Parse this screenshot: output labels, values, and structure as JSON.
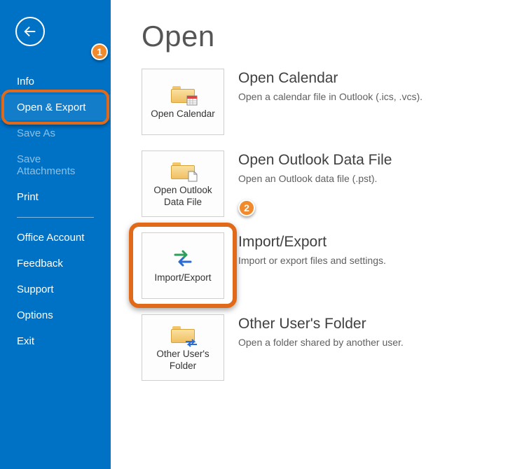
{
  "sidebar": {
    "items": [
      {
        "label": "Info",
        "dim": false
      },
      {
        "label": "Open & Export",
        "dim": false,
        "selected": true
      },
      {
        "label": "Save As",
        "dim": true
      },
      {
        "label": "Save Attachments",
        "dim": true
      },
      {
        "label": "Print",
        "dim": false
      }
    ],
    "items2": [
      {
        "label": "Office Account"
      },
      {
        "label": "Feedback"
      },
      {
        "label": "Support"
      },
      {
        "label": "Options"
      },
      {
        "label": "Exit"
      }
    ]
  },
  "page": {
    "title": "Open"
  },
  "options": [
    {
      "tile_label": "Open Calendar",
      "title": "Open Calendar",
      "desc": "Open a calendar file in Outlook (.ics, .vcs)."
    },
    {
      "tile_label": "Open Outlook Data File",
      "title": "Open Outlook Data File",
      "desc": "Open an Outlook data file (.pst)."
    },
    {
      "tile_label": "Import/Export",
      "title": "Import/Export",
      "desc": "Import or export files and settings."
    },
    {
      "tile_label": "Other User's Folder",
      "title": "Other User's Folder",
      "desc": "Open a folder shared by another user."
    }
  ],
  "annotations": {
    "marker1": "1",
    "marker2": "2"
  }
}
